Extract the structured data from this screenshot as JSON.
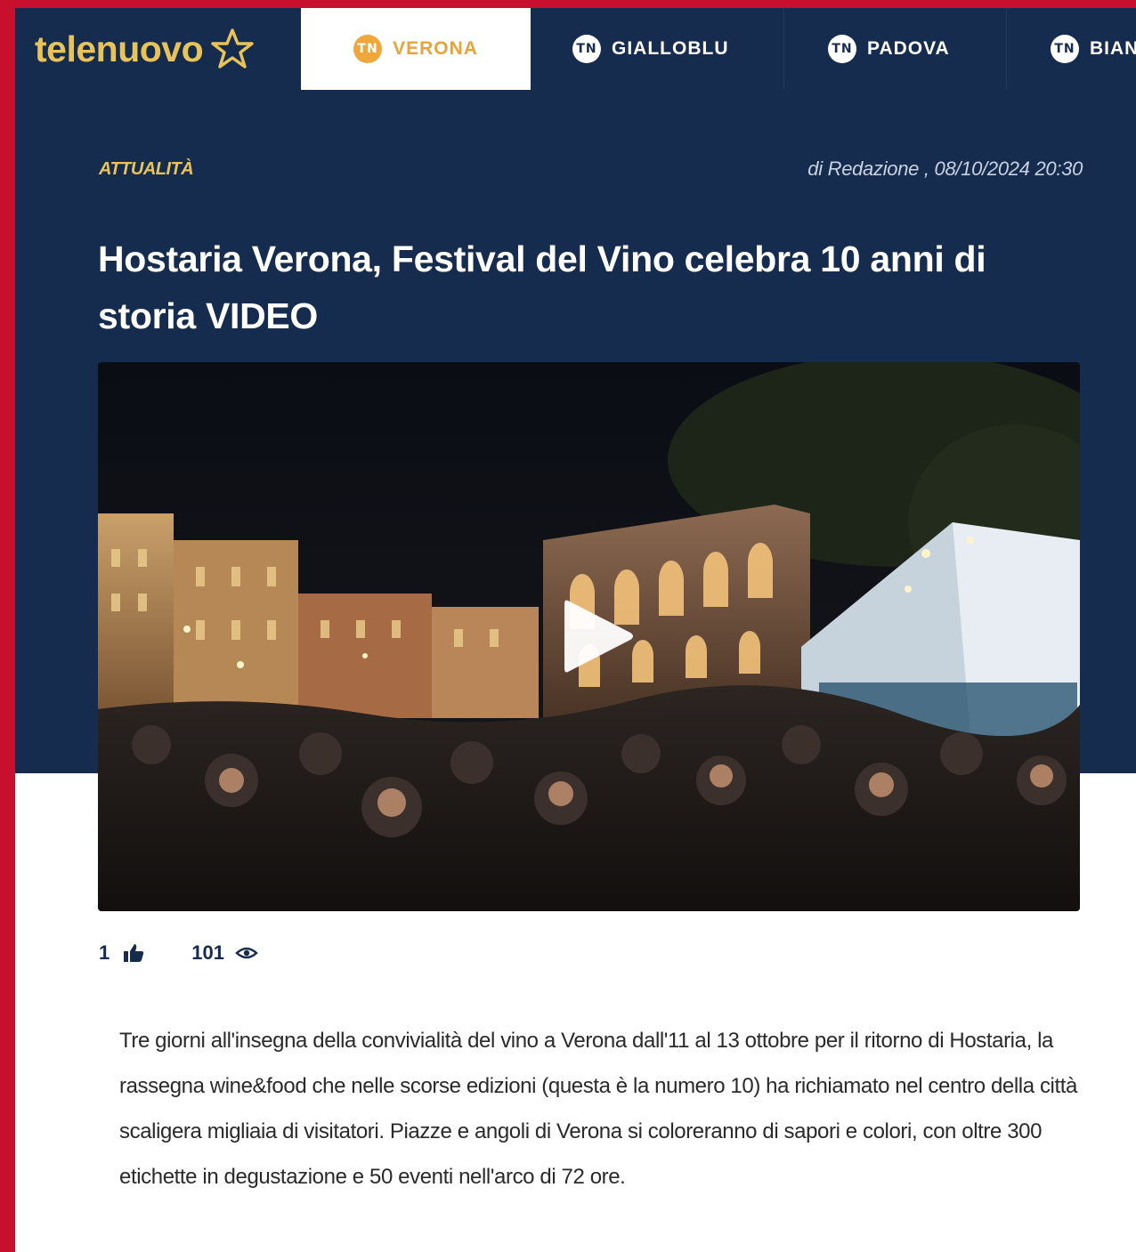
{
  "brand": {
    "logo_text": "telenuovo"
  },
  "nav": {
    "tabs": [
      {
        "label": "VERONA",
        "active": true
      },
      {
        "label": "GIALLOBLU",
        "active": false
      },
      {
        "label": "PADOVA",
        "active": false
      },
      {
        "label": "BIAN",
        "active": false
      }
    ],
    "icon_text": "TN"
  },
  "article": {
    "category": "ATTUALITÀ",
    "byline": "di Redazione , 08/10/2024 20:30",
    "title": "Hostaria Verona, Festival del Vino celebra 10 anni di storia VIDEO",
    "likes": "1",
    "views": "101",
    "body": "Tre giorni all'insegna della convivialità del vino a Verona dall'11 al 13 ottobre per il ritorno di Hostaria, la rassegna wine&food che nelle scorse edizioni (questa è la numero 10) ha richiamato nel centro della città scaligera migliaia di visitatori. Piazze e angoli di Verona si coloreranno di sapori e colori, con oltre 300 etichette in degustazione e 50 eventi nell'arco di 72 ore."
  },
  "icons": {
    "logo": "star-outline-icon",
    "tab": "channel-badge-icon",
    "play": "play-icon",
    "like": "thumbs-up-icon",
    "views": "eye-icon"
  },
  "colors": {
    "page_border": "#c8102e",
    "header_bg": "#162c4e",
    "accent_gold": "#e8c35a",
    "active_tab_text": "#e8a33a"
  }
}
